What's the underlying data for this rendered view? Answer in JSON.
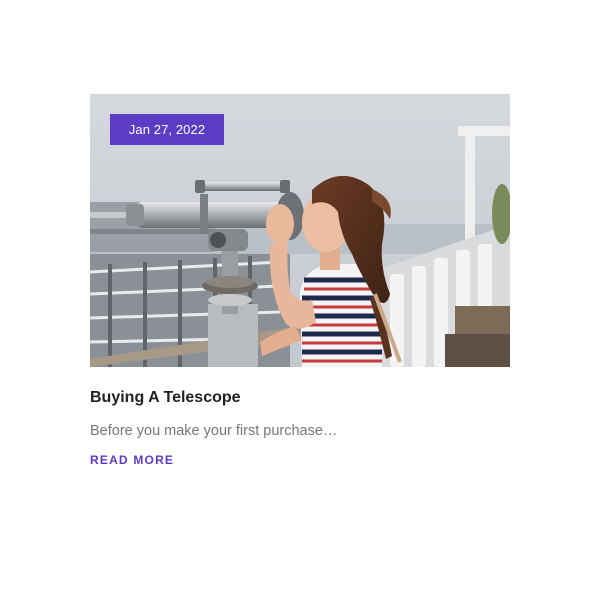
{
  "post": {
    "date": "Jan 27, 2022",
    "title": "Buying A Telescope",
    "excerpt": "Before you make your first purchase…",
    "read_more": "READ MORE"
  },
  "colors": {
    "accent": "#5b3cc4",
    "title": "#222222",
    "excerpt": "#777777"
  },
  "icons": {
    "photo": "woman-looking-through-coin-telescope-photo"
  }
}
